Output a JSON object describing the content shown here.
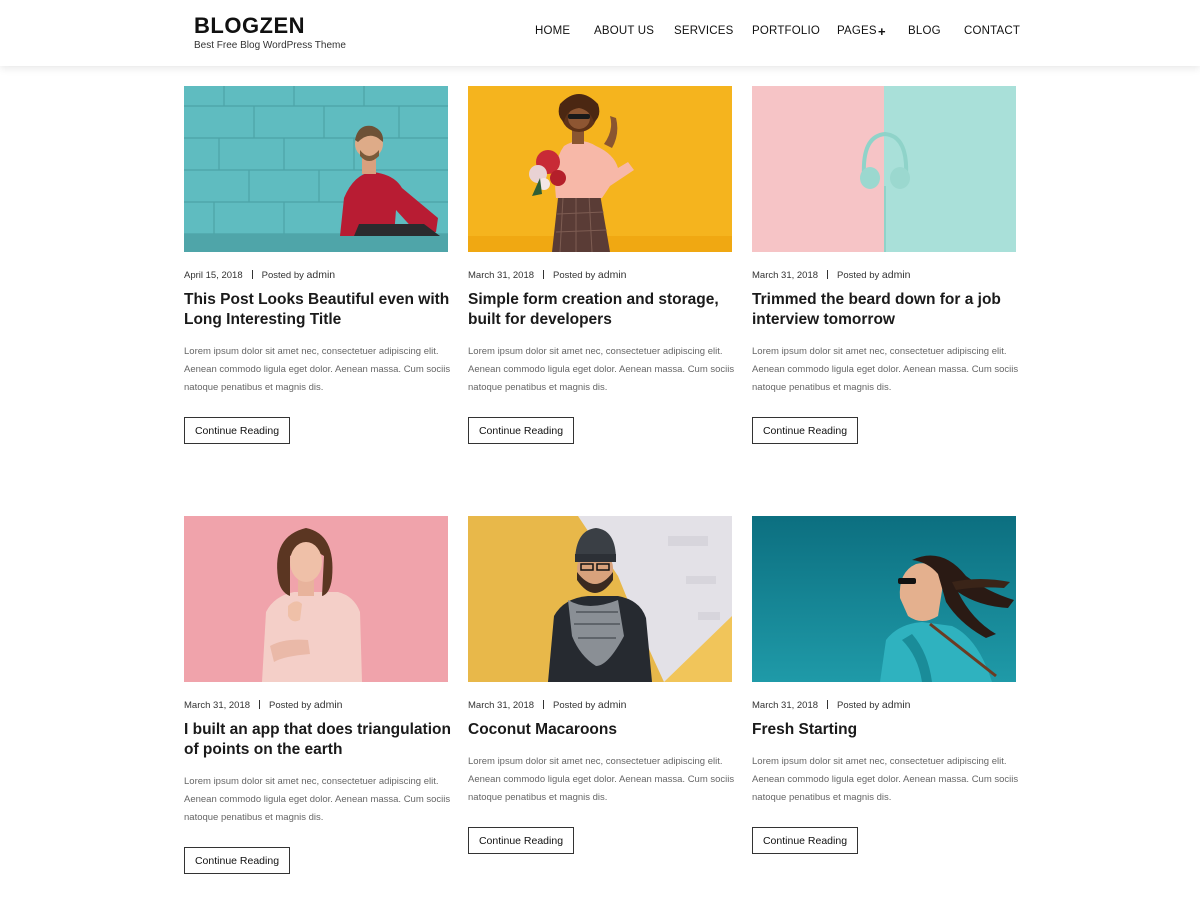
{
  "site": {
    "title": "BLOGZEN",
    "tagline": "Best Free Blog WordPress Theme"
  },
  "nav": {
    "items": [
      {
        "label": "HOME"
      },
      {
        "label": "ABOUT US"
      },
      {
        "label": "SERVICES"
      },
      {
        "label": "PORTFOLIO"
      },
      {
        "label": "PAGES"
      },
      {
        "label": "BLOG"
      },
      {
        "label": "CONTACT"
      }
    ],
    "pages_submenu_icon": "plus-icon"
  },
  "posts": [
    {
      "date": "April 15, 2018",
      "posted_by": "Posted by",
      "author": "admin",
      "title": "This Post Looks Beautiful even with Long Interesting Title",
      "excerpt": "Lorem ipsum dolor sit amet nec, consectetuer adipiscing elit. Aenean commodo ligula eget dolor. Aenean massa. Cum sociis natoque penatibus et magnis dis.",
      "button": "Continue Reading",
      "image": "man-in-red-sweater-on-teal-brick-wall",
      "image_color": "#5fbcc0"
    },
    {
      "date": "March 31, 2018",
      "posted_by": "Posted by",
      "author": "admin",
      "title": "Simple form creation and storage, built for developers",
      "excerpt": "Lorem ipsum dolor sit amet nec, consectetuer adipiscing elit. Aenean commodo ligula eget dolor. Aenean massa. Cum sociis natoque penatibus et magnis dis.",
      "button": "Continue Reading",
      "image": "woman-with-flowers-on-yellow",
      "image_color": "#f5b41e"
    },
    {
      "date": "March 31, 2018",
      "posted_by": "Posted by",
      "author": "admin",
      "title": "Trimmed the beard down for a job interview tomorrow",
      "excerpt": "Lorem ipsum dolor sit amet nec, consectetuer adipiscing elit. Aenean commodo ligula eget dolor. Aenean massa. Cum sociis natoque penatibus et magnis dis.",
      "button": "Continue Reading",
      "image": "headphones-on-pink-and-mint",
      "image_color": "#f6c4c6"
    },
    {
      "date": "March 31, 2018",
      "posted_by": "Posted by",
      "author": "admin",
      "title": "I built an app that does triangulation of points on the earth",
      "excerpt": "Lorem ipsum dolor sit amet nec, consectetuer adipiscing elit. Aenean commodo ligula eget dolor. Aenean massa. Cum sociis natoque penatibus et magnis dis.",
      "button": "Continue Reading",
      "image": "woman-on-pink-background",
      "image_color": "#f0a3ab"
    },
    {
      "date": "March 31, 2018",
      "posted_by": "Posted by",
      "author": "admin",
      "title": "Coconut Macaroons",
      "excerpt": "Lorem ipsum dolor sit amet nec, consectetuer adipiscing elit. Aenean commodo ligula eget dolor. Aenean massa. Cum sociis natoque penatibus et magnis dis.",
      "button": "Continue Reading",
      "image": "man-with-scarf-and-beanie",
      "image_color": "#e8b84a"
    },
    {
      "date": "March 31, 2018",
      "posted_by": "Posted by",
      "author": "admin",
      "title": "Fresh Starting",
      "excerpt": "Lorem ipsum dolor sit amet nec, consectetuer adipiscing elit. Aenean commodo ligula eget dolor. Aenean massa. Cum sociis natoque penatibus et magnis dis.",
      "button": "Continue Reading",
      "image": "woman-windblown-hair-teal",
      "image_color": "#127f8e"
    }
  ]
}
